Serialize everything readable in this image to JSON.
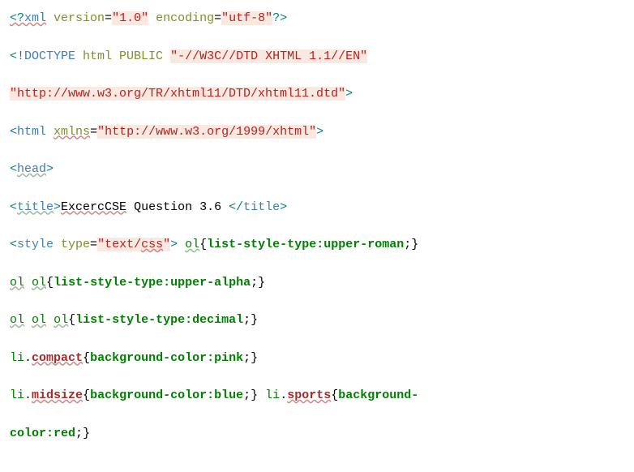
{
  "lines": {
    "l1": "<?xml version=\"1.0\" encoding=\"utf-8\"?>",
    "l2": "<!DOCTYPE html PUBLIC \"-//W3C//DTD XHTML 1.1//EN\"",
    "l3": "\"http://www.w3.org/TR/xhtml11/DTD/xhtml11.dtd\">",
    "l4": "<html xmlns=\"http://www.w3.org/1999/xhtml\">",
    "l5": "<head>",
    "l6": "<title>ExcercCSE Question 3.6 </title>",
    "l7": "<style type=\"text/css\"> ol{list-style-type:upper-roman;}",
    "l8": "ol ol{list-style-type:upper-alpha;}",
    "l9": "ol ol ol{list-style-type:decimal;}",
    "l10": "li.compact{background-color:pink;}",
    "l11": "li.midsize{background-color:blue;} li.sports{background-",
    "l12": "color:red;}"
  },
  "t": {
    "xml": "xml",
    "version": " version",
    "v1": "\"1.0\"",
    "encoding": " encoding",
    "utf8": "\"utf-8\"",
    "doctype": "DOCTYPE",
    "htmlkw": " html ",
    "public": "PUBLIC ",
    "dtd1": "\"-//W3C//DTD XHTML 1.1//EN\"",
    "dtd2": "\"http://www.w3.org/TR/xhtml11/DTD/xhtml11.dtd\"",
    "html": "html",
    "xmlns": "xmlns",
    "xmlnsv": "\"http://www.w3.org/1999/xhtml\"",
    "head": "head",
    "title": "title",
    "titletext": "ExcercCSE",
    "titlerest": " Question 3.6 ",
    "titleclose": "title",
    "style": "style",
    "type": " type",
    "textcss": "\"text/",
    "css": "css",
    "textcssend": "\"",
    "ol": "ol",
    "lbrace": "{",
    "rbrace": "}",
    "semi": ";",
    "lst": "list-style-type",
    "colon": ":",
    "uroman": "upper-roman",
    "ualpha": "upper-alpha",
    "decimal": "decimal",
    "li": "li",
    "dot": ".",
    "compact": "compact",
    "midsize": "midsize",
    "sports": "sports",
    "bgcolor": "background-color",
    "bgonly": "background-",
    "pink": "pink",
    "blue": "blue",
    "red": "red",
    "color": "color",
    "sp": " ",
    "eq": "=",
    "lt": "<",
    "gt": ">",
    "ltq": "<?",
    "qgt": "?>",
    "ltbang": "<!",
    "ltslash": "</"
  }
}
